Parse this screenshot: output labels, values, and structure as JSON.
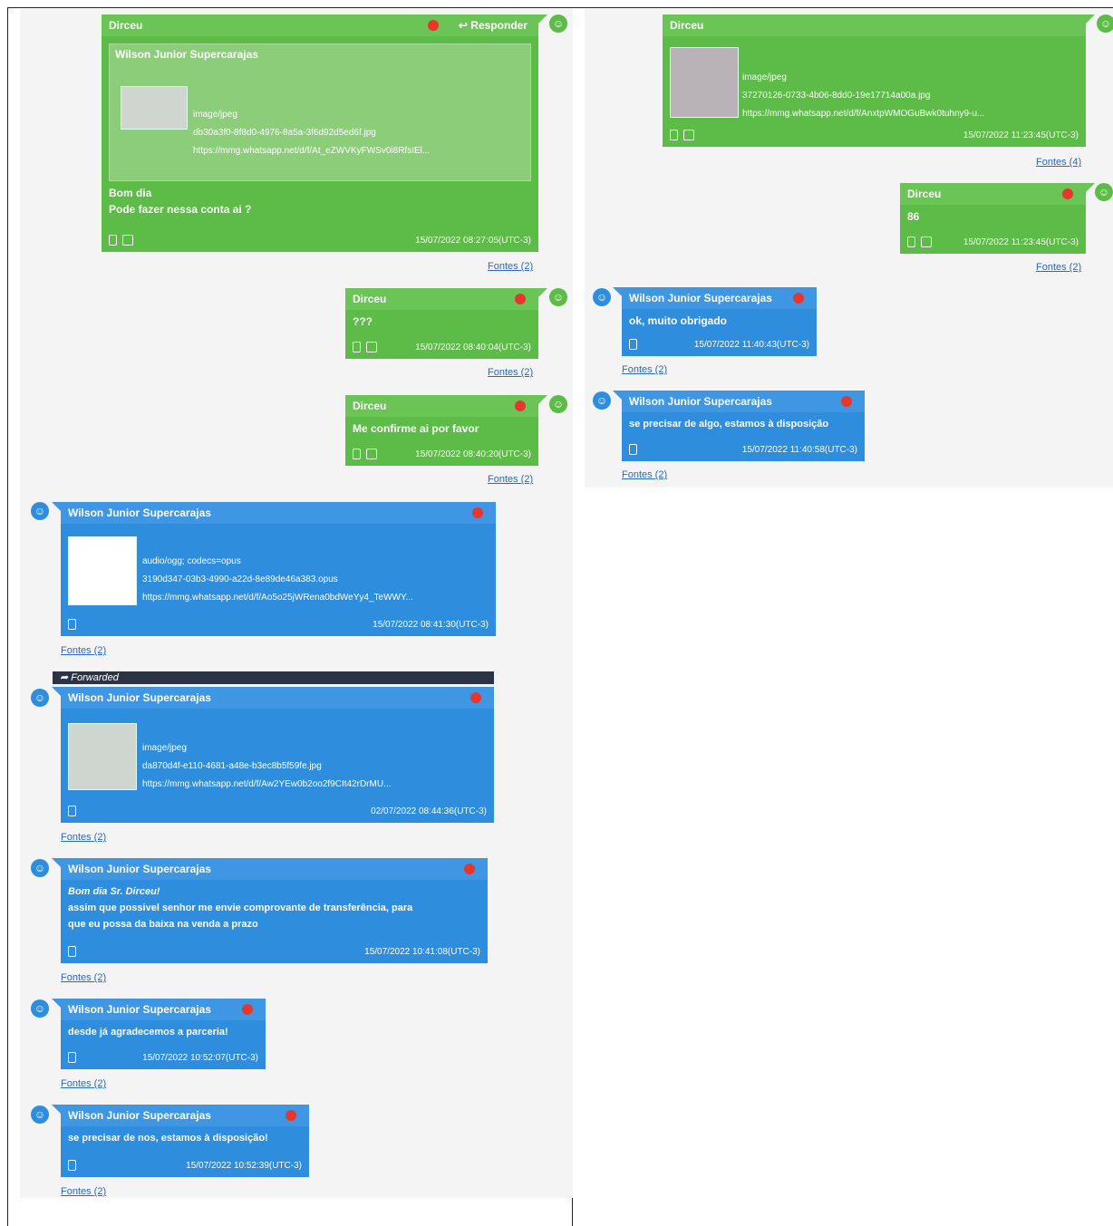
{
  "common": {
    "fontes": "Fontes (2)",
    "fontes4": "Fontes (4)",
    "avatar_glyph": "☺",
    "phone_icon": "phone-icon",
    "doc_icon": "document-icon"
  },
  "left": {
    "m1": {
      "sender": "Dirceu",
      "reply_label": "↩ Responder",
      "quote_sender": "Wilson Junior Supercarajas",
      "att_type": "image/jpeg",
      "att_name": "db30a3f0-8f8d0-4976-8a5a-3f6d92d5ed6f.jpg",
      "att_url": "https://mmg.whatsapp.net/d/f/At_eZWVKyFWSv0i8RfsIEl...",
      "text1": "Bom dia",
      "text2": "Pode fazer nessa conta ai ?",
      "time": "15/07/2022 08:27:05(UTC-3)"
    },
    "m2": {
      "sender": "Dirceu",
      "text": "???",
      "time": "15/07/2022 08:40:04(UTC-3)"
    },
    "m3": {
      "sender": "Dirceu",
      "text": "Me confirme ai por favor",
      "time": "15/07/2022 08:40:20(UTC-3)"
    },
    "m4": {
      "sender": "Wilson Junior Supercarajas",
      "att_type": "audio/ogg; codecs=opus",
      "att_name": "3190d347-03b3-4990-a22d-8e89de46a383.opus",
      "att_url": "https://mmg.whatsapp.net/d/f/Ao5o25jWRena0bdWeYy4_TeWWY...",
      "time": "15/07/2022 08:41:30(UTC-3)"
    },
    "fwd_label": "Forwarded",
    "m5": {
      "sender": "Wilson Junior Supercarajas",
      "att_type": "image/jpeg",
      "att_name": "da870d4f-e110-4681-a48e-b3ec8b5f59fe.jpg",
      "att_url": "https://mmg.whatsapp.net/d/f/Aw2YEw0b2oo2f9CIt42rDrMU...",
      "time": "02/07/2022 08:44:36(UTC-3)"
    },
    "m6": {
      "sender": "Wilson Junior Supercarajas",
      "text1": "Bom dia Sr. Dirceu!",
      "text2": "assim que possivel senhor me envie comprovante de transferência, para",
      "text3": "que eu possa da baixa na venda a prazo",
      "time": "15/07/2022 10:41:08(UTC-3)"
    },
    "m7": {
      "sender": "Wilson Junior Supercarajas",
      "text": "desde já agradecemos a parceria!",
      "time": "15/07/2022 10:52:07(UTC-3)"
    },
    "m8": {
      "sender": "Wilson Junior Supercarajas",
      "text": "se precisar de nos, estamos à disposição!",
      "time": "15/07/2022 10:52:39(UTC-3)"
    }
  },
  "right": {
    "m1": {
      "sender": "Dirceu",
      "att_type": "image/jpeg",
      "att_name": "37270126-0733-4b06-8dd0-19e17714a00a.jpg",
      "att_url": "https://mmg.whatsapp.net/d/f/AnxtpWMOGuBwk0tuhny9-u...",
      "time": "15/07/2022 11:23:45(UTC-3)"
    },
    "m2": {
      "sender": "Dirceu",
      "text": "86",
      "time": "15/07/2022 11:23:45(UTC-3)"
    },
    "m3": {
      "sender": "Wilson Junior Supercarajas",
      "text": "ok, muito obrigado",
      "time": "15/07/2022 11:40:43(UTC-3)"
    },
    "m4": {
      "sender": "Wilson Junior Supercarajas",
      "text": "se precisar de algo, estamos à disposição",
      "time": "15/07/2022 11:40:58(UTC-3)"
    }
  }
}
